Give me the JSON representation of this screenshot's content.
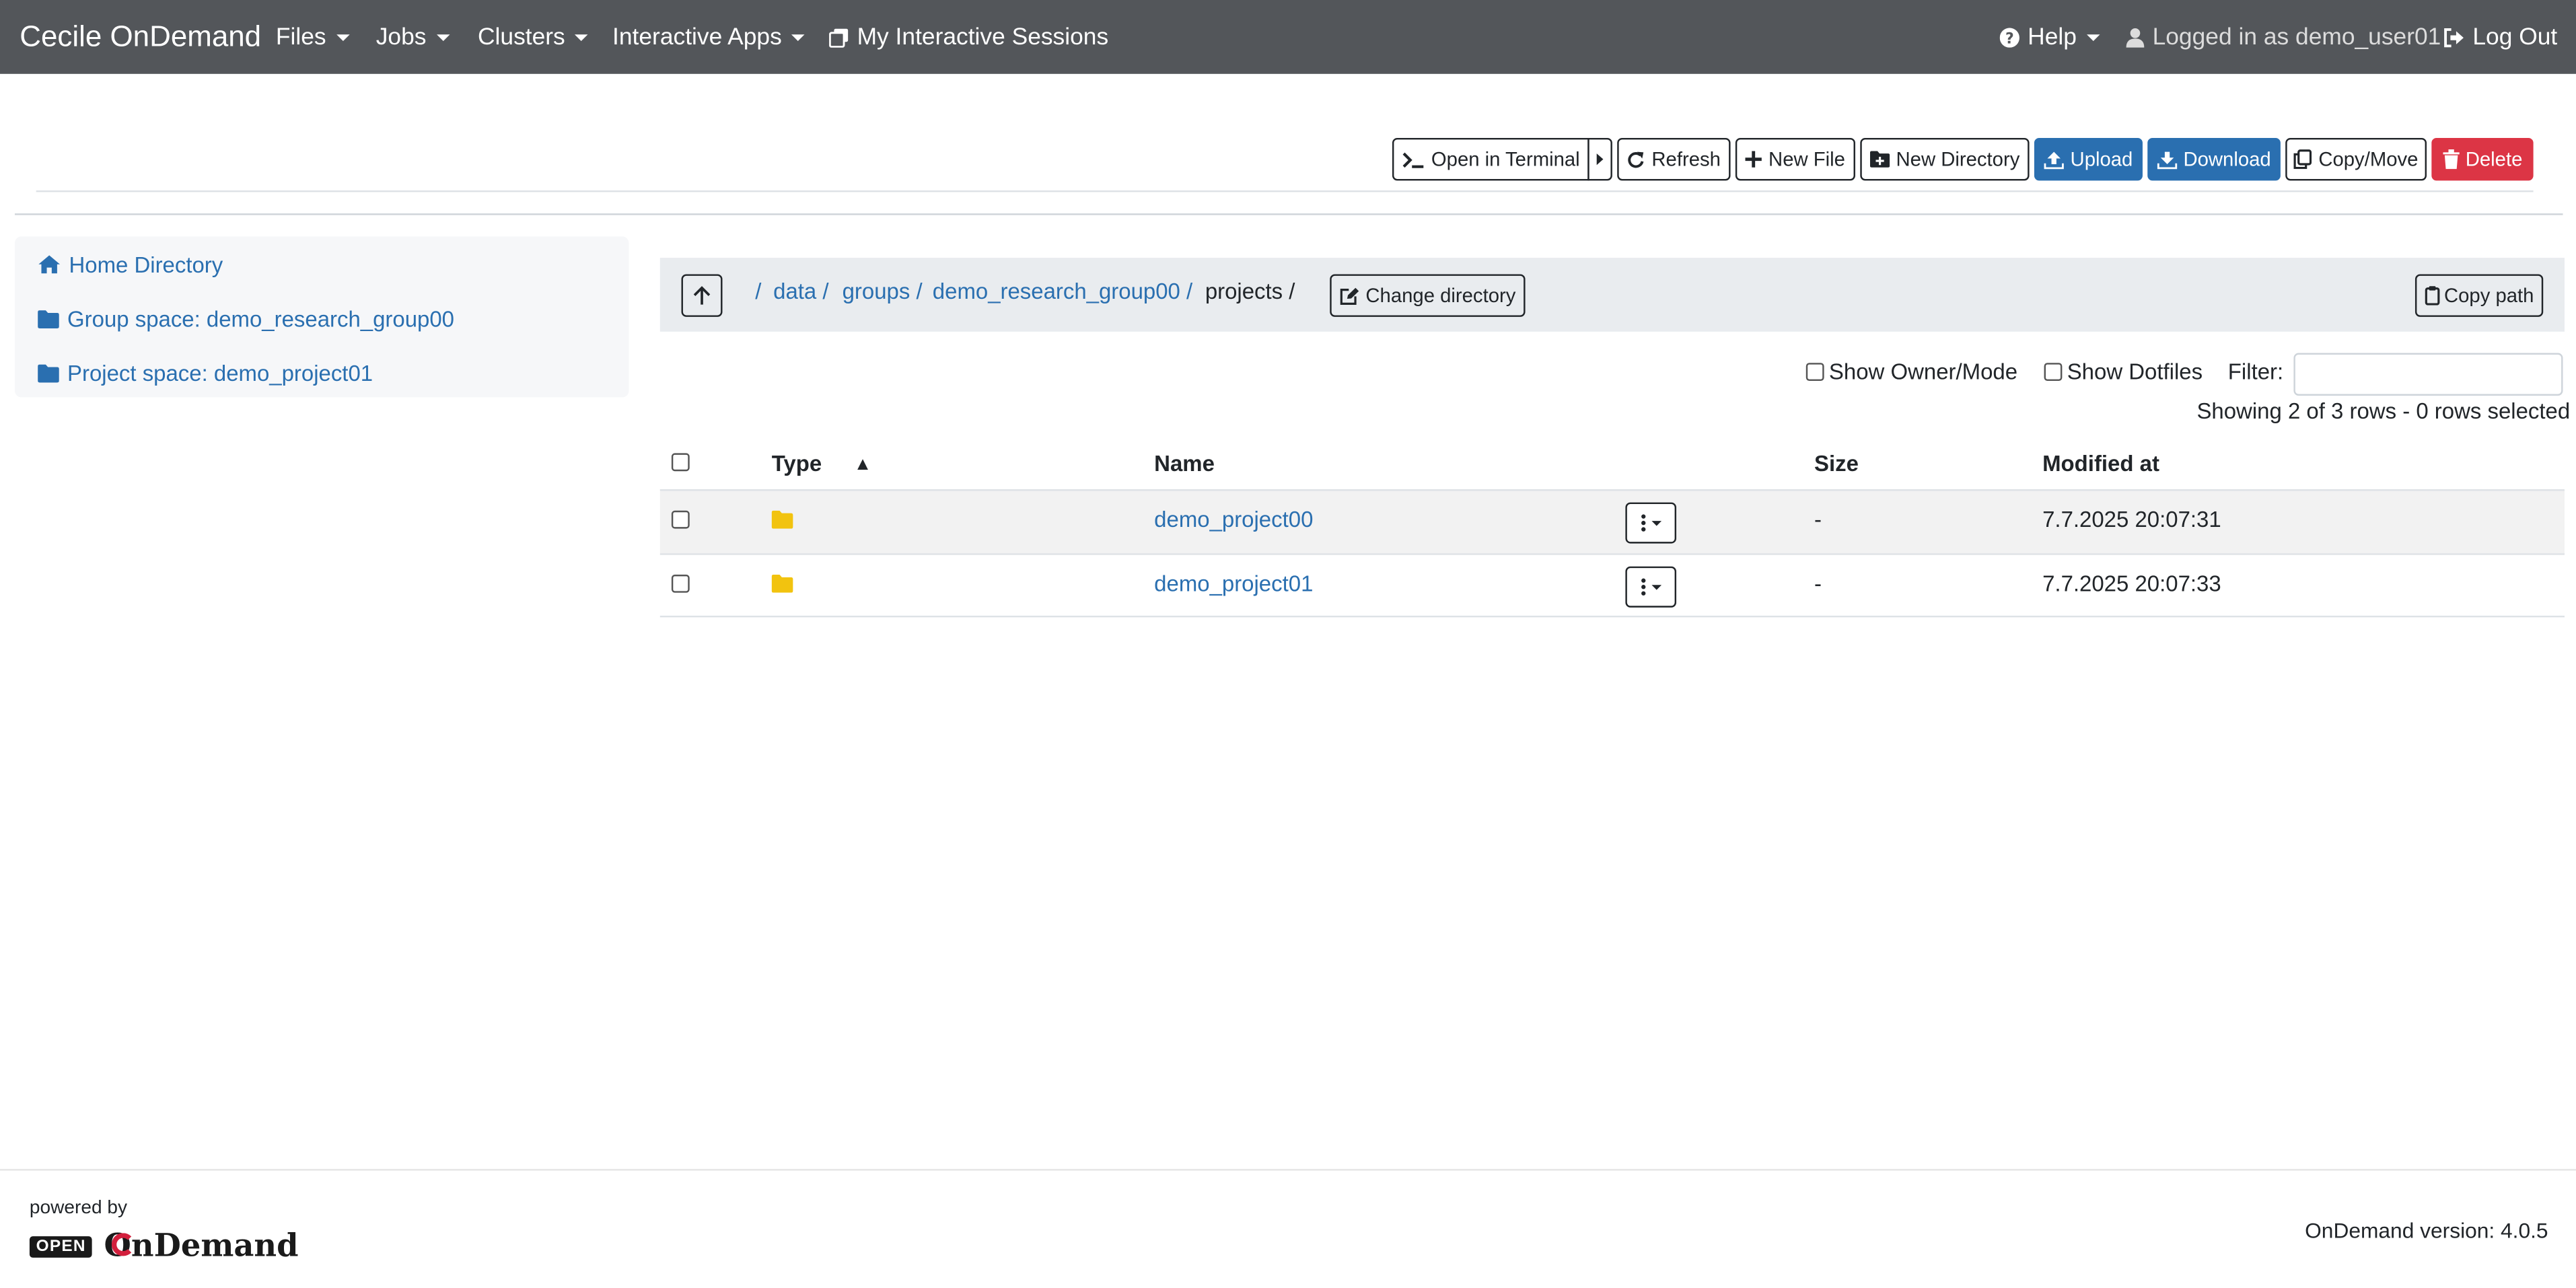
{
  "navbar": {
    "brand": "Cecile OnDemand",
    "menus": [
      "Files",
      "Jobs",
      "Clusters",
      "Interactive Apps"
    ],
    "sessions": "My Interactive Sessions",
    "help": "Help",
    "user": "Logged in as demo_user01",
    "logout": "Log Out"
  },
  "toolbar": {
    "terminal": "Open in Terminal",
    "refresh": "Refresh",
    "new_file": "New File",
    "new_directory": "New Directory",
    "upload": "Upload",
    "download": "Download",
    "copy_move": "Copy/Move",
    "delete": "Delete"
  },
  "sidebar": {
    "items": [
      {
        "label": "Home Directory",
        "icon": "home-icon"
      },
      {
        "label": "Group space: demo_research_group00",
        "icon": "folder-icon"
      },
      {
        "label": "Project space: demo_project01",
        "icon": "folder-icon"
      }
    ]
  },
  "breadcrumb": {
    "root": "/",
    "parts": [
      "data /",
      "groups /",
      "demo_research_group00 /"
    ],
    "current": "projects /",
    "change_directory": "Change directory",
    "copy_path": "Copy path"
  },
  "options": {
    "show_owner": "Show Owner/Mode",
    "show_dotfiles": "Show Dotfiles",
    "filter_label": "Filter:",
    "filter_value": "",
    "summary": "Showing 2 of 3 rows - 0 rows selected"
  },
  "table": {
    "columns": [
      "Type",
      "Name",
      "Size",
      "Modified at"
    ],
    "sort_indicator": "▲",
    "rows": [
      {
        "type": "folder",
        "name": "demo_project00",
        "size": "-",
        "modified": "7.7.2025 20:07:31"
      },
      {
        "type": "folder",
        "name": "demo_project01",
        "size": "-",
        "modified": "7.7.2025 20:07:33"
      }
    ]
  },
  "footer": {
    "powered_by": "powered by",
    "logo_open": "OPEN",
    "logo_text": "OnDemand",
    "version": "OnDemand version: 4.0.5"
  },
  "colors": {
    "navbar": "#53565a",
    "link": "#2a6fb0",
    "primary": "#2a6fb0",
    "danger": "#dc3545",
    "folder": "#f2c30f"
  }
}
